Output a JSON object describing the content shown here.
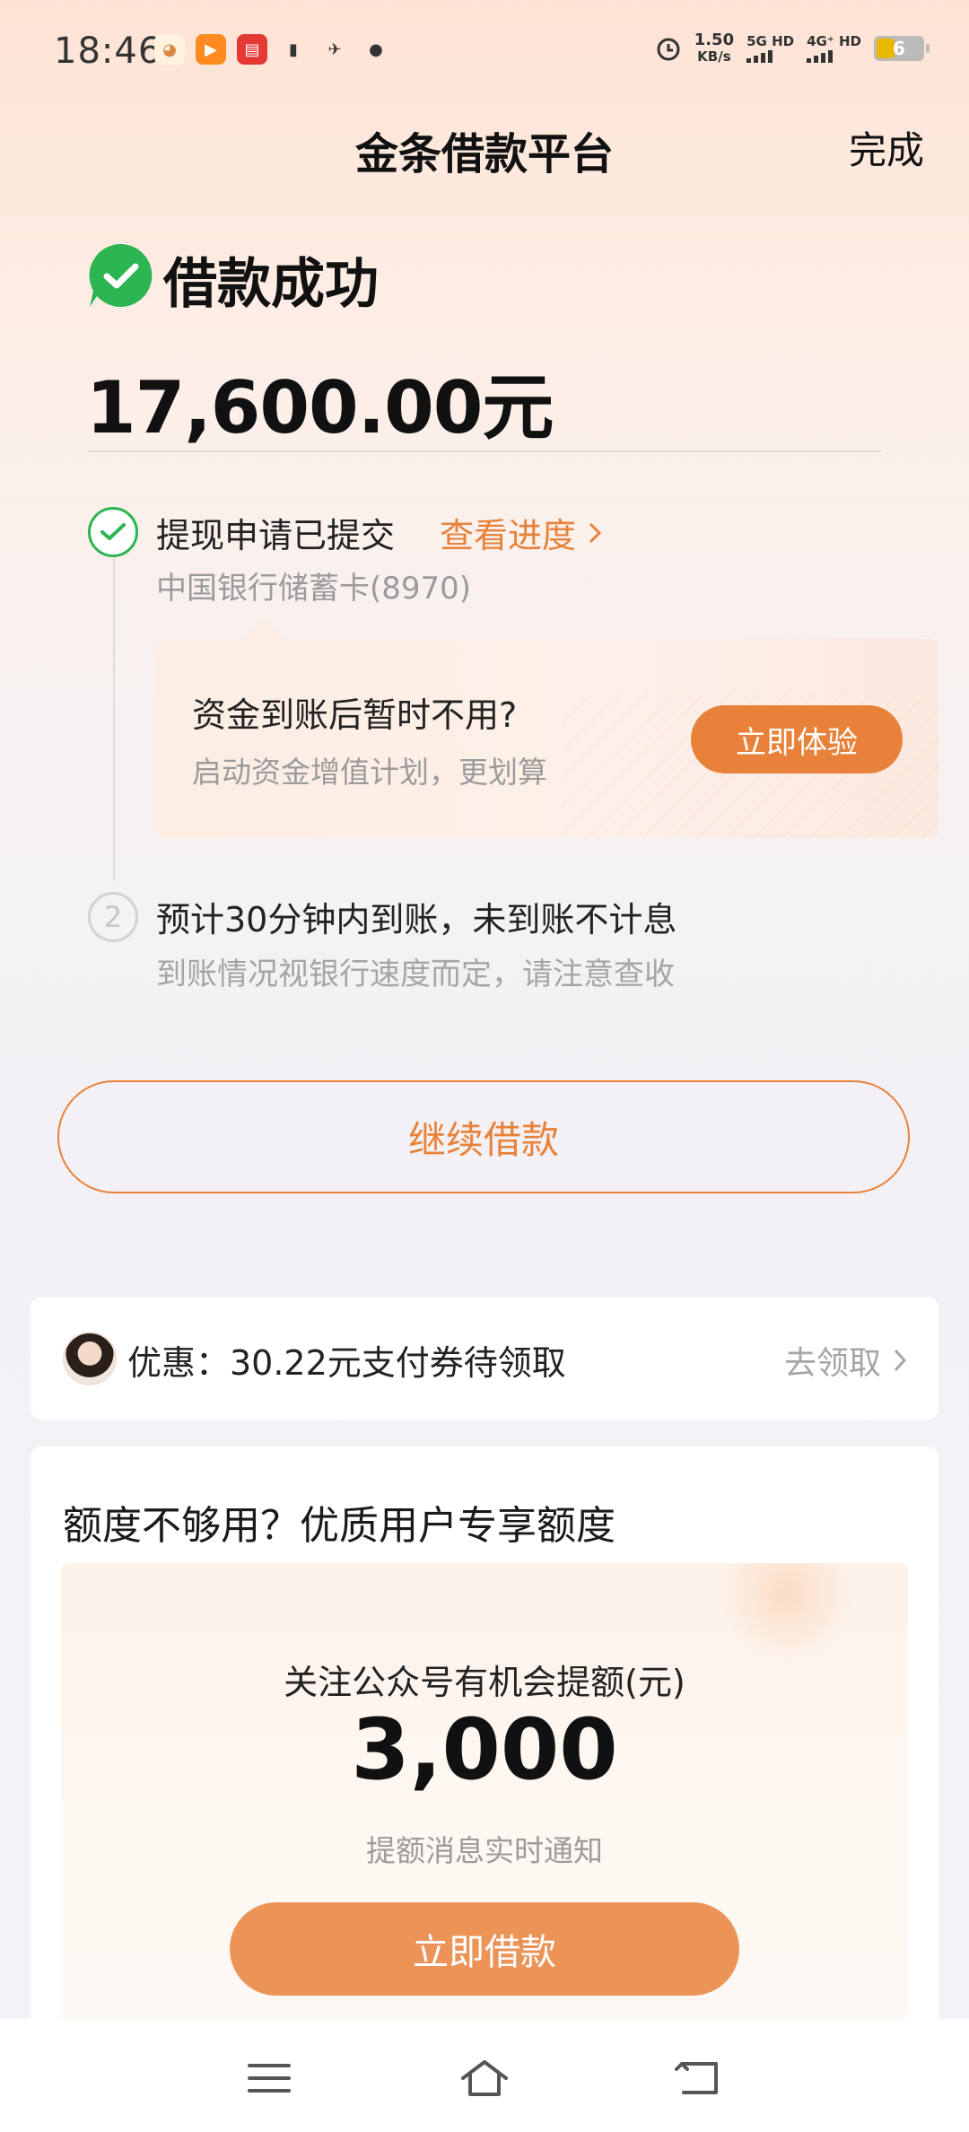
{
  "status_bar": {
    "time": "18:46",
    "speed_value": "1.50",
    "speed_unit": "KB/s",
    "net1": "5G HD",
    "net2": "4G⁺ HD",
    "battery": "6",
    "app_icons": [
      "app-icon-1",
      "app-icon-2",
      "app-icon-3",
      "battery-saver-icon",
      "bird-icon",
      "message-icon"
    ]
  },
  "nav": {
    "title": "金条借款平台",
    "done": "完成"
  },
  "result": {
    "title": "借款成功",
    "amount": "17,600.00元"
  },
  "steps": {
    "step1_title": "提现申请已提交",
    "step1_link": "查看进度",
    "step1_sub": "中国银行储蓄卡(8970)",
    "step2_number": "2",
    "step2_title": "预计30分钟内到账，未到账不计息",
    "step2_sub": "到账情况视银行速度而定，请注意查收"
  },
  "promo": {
    "title": "资金到账后暂时不用?",
    "subtitle": "启动资金增值计划，更划算",
    "button": "立即体验"
  },
  "continue_button": "继续借款",
  "coupon": {
    "text": "优惠：30.22元支付券待领取",
    "link": "去领取"
  },
  "quota": {
    "title": "额度不够用？优质用户专享额度",
    "caption": "关注公众号有机会提额(元)",
    "amount": "3,000",
    "note": "提额消息实时通知",
    "button": "立即借款"
  },
  "colors": {
    "accent": "#e8823a",
    "success": "#2db552"
  }
}
